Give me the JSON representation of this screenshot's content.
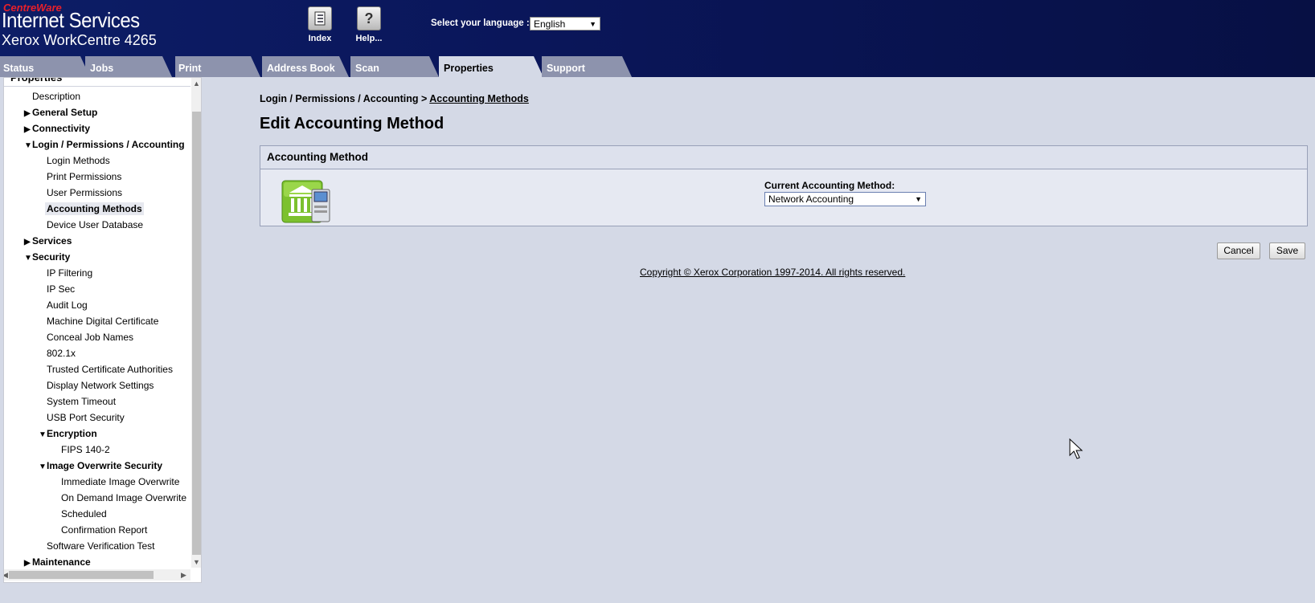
{
  "header": {
    "brand_sub": "CentreWare",
    "brand_main": "Internet Services",
    "model": "Xerox WorkCentre 4265",
    "index_label": "Index",
    "help_label": "Help...",
    "language_label": "Select your language :",
    "language_value": "English"
  },
  "tabs": [
    "Status",
    "Jobs",
    "Print",
    "Address Book",
    "Scan",
    "Properties",
    "Support"
  ],
  "sidebar": {
    "title": "Properties",
    "items": [
      {
        "label": "Description"
      },
      {
        "label": "General Setup"
      },
      {
        "label": "Connectivity"
      },
      {
        "label": "Login / Permissions / Accounting"
      },
      {
        "label": "Login Methods"
      },
      {
        "label": "Print Permissions"
      },
      {
        "label": "User Permissions"
      },
      {
        "label": "Accounting Methods"
      },
      {
        "label": "Device User Database"
      },
      {
        "label": "Services"
      },
      {
        "label": "Security"
      },
      {
        "label": "IP Filtering"
      },
      {
        "label": "IP Sec"
      },
      {
        "label": "Audit Log"
      },
      {
        "label": "Machine Digital Certificate"
      },
      {
        "label": "Conceal Job Names"
      },
      {
        "label": "802.1x"
      },
      {
        "label": "Trusted Certificate Authorities"
      },
      {
        "label": "Display Network Settings"
      },
      {
        "label": "System Timeout"
      },
      {
        "label": "USB Port Security"
      },
      {
        "label": "Encryption"
      },
      {
        "label": "FIPS 140-2"
      },
      {
        "label": "Image Overwrite Security"
      },
      {
        "label": "Immediate Image Overwrite"
      },
      {
        "label": "On Demand Image Overwrite"
      },
      {
        "label": "Scheduled"
      },
      {
        "label": "Confirmation Report"
      },
      {
        "label": "Software Verification Test"
      },
      {
        "label": "Maintenance"
      }
    ]
  },
  "main": {
    "breadcrumb_prefix": "Login / Permissions / Accounting >",
    "breadcrumb_link": "Accounting Methods",
    "title": "Edit Accounting Method",
    "panel_title": "Accounting Method",
    "current_label": "Current Accounting Method:",
    "current_value": "Network Accounting",
    "cancel_label": "Cancel",
    "save_label": "Save",
    "copyright": "Copyright © Xerox Corporation 1997-2014. All rights reserved."
  }
}
